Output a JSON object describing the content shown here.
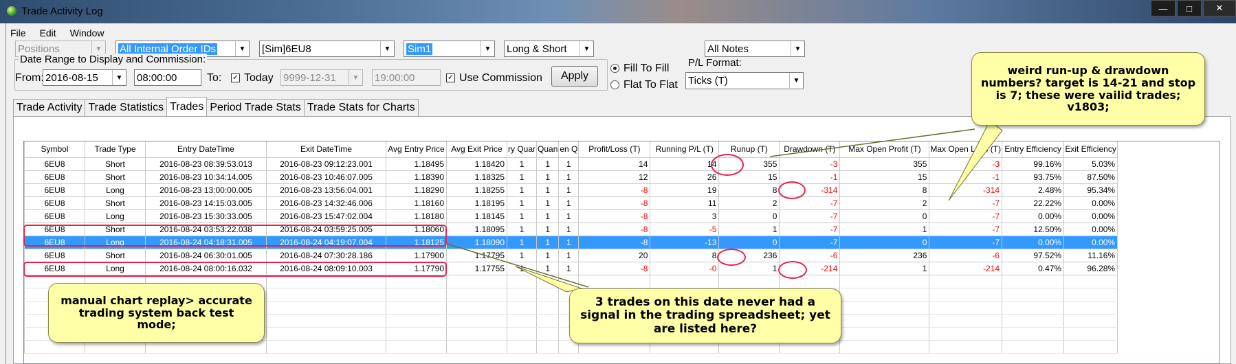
{
  "window": {
    "title": "Trade Activity Log",
    "minimize": "—",
    "maximize": "□",
    "close": "✕"
  },
  "menu": [
    "File",
    "Edit",
    "Window"
  ],
  "filters": {
    "positions": "Positions",
    "order_ids": "All Internal Order IDs",
    "instrument": "[Sim]6EU8",
    "account": "Sim1",
    "side": "Long & Short",
    "notes": "All Notes"
  },
  "date_range": {
    "group_label": "Date Range to Display and Commission:",
    "from_label": "From:",
    "from_date": "2016-08-15",
    "from_time": "08:00:00",
    "to_label": "To:",
    "today_checked": true,
    "today_label": "Today",
    "to_date": "9999-12-31",
    "to_time": "19:00:00",
    "use_commission_checked": true,
    "use_commission_label": "Use Commission",
    "apply_label": "Apply"
  },
  "fill_mode": {
    "fill_to_fill": "Fill To Fill",
    "flat_to_flat": "Flat To Flat",
    "selected": "fill_to_fill"
  },
  "pl_format": {
    "label": "P/L Format:",
    "value": "Ticks (T)"
  },
  "tabs": [
    "Trade Activity",
    "Trade Statistics",
    "Trades",
    "Period Trade Stats",
    "Trade Stats for Charts"
  ],
  "active_tab": 2,
  "grid": {
    "columns": [
      "Symbol",
      "Trade Type",
      "Entry DateTime",
      "Exit DateTime",
      "Avg Entry Price",
      "Avg Exit Price",
      "ry Quar",
      "Quan",
      "en Q",
      "Profit/Loss (T)",
      "Running P/L (T)",
      "Runup (T)",
      "Drawdown (T)",
      "Max Open Profit (T)",
      "Max Open Loss (T)",
      "Entry Efficiency",
      "Exit Efficiency"
    ],
    "rows": [
      [
        "6EU8",
        "Short",
        "2016-08-23  08:39:53.013",
        "2016-08-23  09:12:23.001",
        "1.18495",
        "1.18420",
        "1",
        "1",
        "1",
        "14",
        "14",
        "355",
        "-3",
        "355",
        "-3",
        "99.16%",
        "5.03%"
      ],
      [
        "6EU8",
        "Short",
        "2016-08-23  10:34:14.005",
        "2016-08-23  10:46:07.005",
        "1.18390",
        "1.18325",
        "1",
        "1",
        "1",
        "12",
        "26",
        "15",
        "-1",
        "15",
        "-1",
        "93.75%",
        "87.50%"
      ],
      [
        "6EU8",
        "Long",
        "2016-08-23  13:00:00.005",
        "2016-08-23  13:56:04.001",
        "1.18290",
        "1.18255",
        "1",
        "1",
        "1",
        "-8",
        "19",
        "8",
        "-314",
        "8",
        "-314",
        "2.48%",
        "95.34%"
      ],
      [
        "6EU8",
        "Short",
        "2016-08-23  14:15:03.005",
        "2016-08-23  14:32:46.006",
        "1.18160",
        "1.18195",
        "1",
        "1",
        "1",
        "-8",
        "11",
        "2",
        "-7",
        "2",
        "-7",
        "22.22%",
        "0.00%"
      ],
      [
        "6EU8",
        "Long",
        "2016-08-23  15:30:33.005",
        "2016-08-23  15:47:02.004",
        "1.18180",
        "1.18145",
        "1",
        "1",
        "1",
        "-8",
        "3",
        "0",
        "-7",
        "0",
        "-7",
        "0.00%",
        "0.00%"
      ],
      [
        "6EU8",
        "Short",
        "2016-08-24  03:53:22.038",
        "2016-08-24  03:59:25.005",
        "1.18060",
        "1.18095",
        "1",
        "1",
        "1",
        "-8",
        "-5",
        "1",
        "-7",
        "1",
        "-7",
        "12.50%",
        "0.00%"
      ],
      [
        "6EU8",
        "Long",
        "2016-08-24  04:18:31.005",
        "2016-08-24  04:19:07.004",
        "1.18125",
        "1.18090",
        "1",
        "1",
        "1",
        "-8",
        "-13",
        "0",
        "-7",
        "0",
        "-7",
        "0.00%",
        "0.00%"
      ],
      [
        "6EU8",
        "Short",
        "2016-08-24  06:30:01.005",
        "2016-08-24  07:30:28.186",
        "1.17900",
        "1.17795",
        "1",
        "1",
        "1",
        "20",
        "8",
        "236",
        "-6",
        "236",
        "-6",
        "97.52%",
        "11.16%"
      ],
      [
        "6EU8",
        "Long",
        "2016-08-24  08:00:16.032",
        "2016-08-24  08:09:10.003",
        "1.17790",
        "1.17755",
        "1",
        "1",
        "1",
        "-8",
        "-0",
        "1",
        "-214",
        "1",
        "-214",
        "0.47%",
        "96.28%"
      ]
    ],
    "selected_row": 6
  },
  "annotations": {
    "top_right": "weird run-up & drawdown numbers? target is 14-21 and stop is 7; these were vailid trades; v1803;",
    "bottom_left": "manual chart replay> accurate trading system back test mode;",
    "bottom_middle": "3 trades on this date never had a signal in the trading spreadsheet; yet are listed here?"
  },
  "colors": {
    "selection": "#3399ff",
    "negative": "#ff0000",
    "callout": "#ffffa8",
    "highlight": "#e8224a"
  }
}
